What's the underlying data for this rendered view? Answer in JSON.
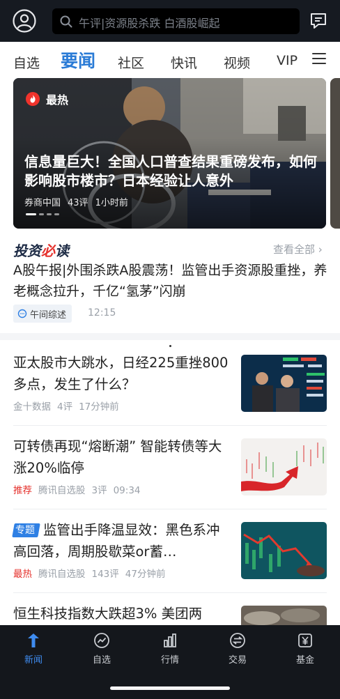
{
  "header": {
    "avatar_icon": "user-avatar-icon",
    "search_icon": "search-icon",
    "search_placeholder": "午评|资源股杀跌 白酒股崛起",
    "message_icon": "message-icon"
  },
  "tabs": [
    {
      "label": "自选",
      "active": false
    },
    {
      "label": "要闻",
      "active": true
    },
    {
      "label": "社区",
      "active": false
    },
    {
      "label": "快讯",
      "active": false
    },
    {
      "label": "视频",
      "active": false
    },
    {
      "label": "VIP",
      "active": false
    }
  ],
  "menu_icon": "hamburger-menu-icon",
  "hero": {
    "badge": "最热",
    "title": "信息量巨大！全国人口普查结果重磅发布，如何影响股市楼市？日本经验让人意外",
    "source": "券商中国",
    "comments": "43评",
    "time": "1小时前",
    "slide_index": 0,
    "slide_count": 4
  },
  "must_read": {
    "logo_part1": "投资",
    "logo_part2": "必",
    "logo_part3": "读",
    "more": "查看全部",
    "title": "A股午报|外围杀跌A股震荡！监管出手资源股重挫，养老概念拉升，千亿“氢茅”闪崩",
    "tag": "午间综述",
    "time": "12:15"
  },
  "news": [
    {
      "title": "亚太股市大跳水，日经225重挫800多点，发生了什么？",
      "label": "",
      "source": "金十数据",
      "comments": "4评",
      "time": "17分钟前",
      "thumb": "stock-board-men-photo"
    },
    {
      "title": "可转债再现“熔断潮” 智能转债等大涨20%临停",
      "label": "推荐",
      "source": "腾讯自选股",
      "comments": "3评",
      "time": "09:34",
      "thumb": "candlestick-arrow-up-photo"
    },
    {
      "topic": "专题",
      "title": "监管出手降温显效：黑色系冲高回落，周期股歇菜or蓄…",
      "label": "最热",
      "source": "腾讯自选股",
      "comments": "143评",
      "time": "47分钟前",
      "thumb": "market-drop-arrow-photo"
    },
    {
      "title": "恒生科技指数大跌超3% 美团两",
      "thumb": "coins-photo"
    }
  ],
  "bottom_nav": [
    {
      "label": "新闻",
      "icon": "news-icon",
      "active": true
    },
    {
      "label": "自选",
      "icon": "watchlist-icon",
      "active": false
    },
    {
      "label": "行情",
      "icon": "market-bars-icon",
      "active": false
    },
    {
      "label": "交易",
      "icon": "trade-icon",
      "active": false
    },
    {
      "label": "基金",
      "icon": "fund-yen-icon",
      "active": false
    }
  ],
  "colors": {
    "accent": "#2a7bd6",
    "hot_red": "#e5322d",
    "topbar_bg": "#161a21",
    "nav_bg": "#14171c"
  }
}
